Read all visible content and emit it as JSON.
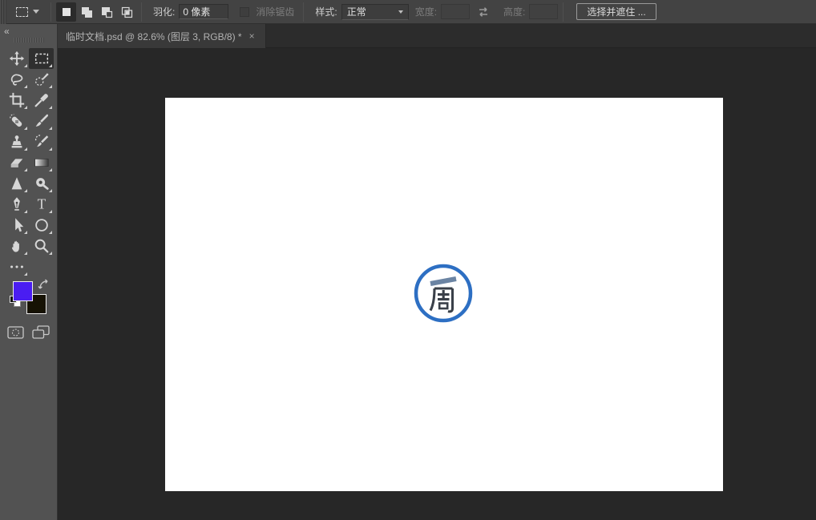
{
  "options_bar": {
    "tool_preset_icon": "rectangular-marquee-icon",
    "selection_modes": [
      {
        "icon": "new-selection-icon",
        "selected": true
      },
      {
        "icon": "add-to-selection-icon",
        "selected": false
      },
      {
        "icon": "subtract-from-selection-icon",
        "selected": false
      },
      {
        "icon": "intersect-selection-icon",
        "selected": false
      }
    ],
    "feather_label": "羽化:",
    "feather_value": "0 像素",
    "anti_alias_label": "消除锯齿",
    "anti_alias_checked": false,
    "anti_alias_enabled": false,
    "style_label": "样式:",
    "style_value": "正常",
    "width_label": "宽度:",
    "width_value": "",
    "swap_icon": "swap-width-height-icon",
    "height_label": "高度:",
    "height_value": "",
    "select_and_mask_label": "选择并遮住 ..."
  },
  "tab_bar": {
    "tabs": [
      {
        "title": "临时文档.psd @ 82.6% (图层 3, RGB/8) *",
        "close_glyph": "×",
        "active": true
      }
    ]
  },
  "tool_panel": {
    "collapse_glyph": "«",
    "tools": [
      {
        "icon": "move-tool-icon",
        "selected": false
      },
      {
        "icon": "rectangular-marquee-tool-icon",
        "selected": true
      },
      {
        "icon": "lasso-tool-icon",
        "selected": false
      },
      {
        "icon": "quick-selection-tool-icon",
        "selected": false
      },
      {
        "icon": "crop-tool-icon",
        "selected": false
      },
      {
        "icon": "eyedropper-tool-icon",
        "selected": false
      },
      {
        "icon": "spot-healing-brush-tool-icon",
        "selected": false
      },
      {
        "icon": "brush-tool-icon",
        "selected": false
      },
      {
        "icon": "clone-stamp-tool-icon",
        "selected": false
      },
      {
        "icon": "history-brush-tool-icon",
        "selected": false
      },
      {
        "icon": "eraser-tool-icon",
        "selected": false
      },
      {
        "icon": "gradient-tool-icon",
        "selected": false
      },
      {
        "icon": "sharpen-tool-icon",
        "selected": false
      },
      {
        "icon": "dodge-tool-icon",
        "selected": false
      },
      {
        "icon": "pen-tool-icon",
        "selected": false
      },
      {
        "icon": "type-tool-icon",
        "selected": false
      },
      {
        "icon": "path-selection-tool-icon",
        "selected": false
      },
      {
        "icon": "ellipse-tool-icon",
        "selected": false
      },
      {
        "icon": "hand-tool-icon",
        "selected": false
      },
      {
        "icon": "zoom-tool-icon",
        "selected": false
      },
      {
        "icon": "edit-toolbar-icon",
        "selected": false
      }
    ],
    "type_tool_glyph": "T",
    "foreground_color": "#4a1df2",
    "background_color": "#161204"
  },
  "canvas": {
    "background_color": "#ffffff",
    "zoom_percent": "82.6%",
    "logo": {
      "circle_color": "#2d6fc3",
      "top_char": "一",
      "top_char_color": "#6b84a3",
      "main_char": "周",
      "main_char_color": "#3a4049"
    }
  }
}
